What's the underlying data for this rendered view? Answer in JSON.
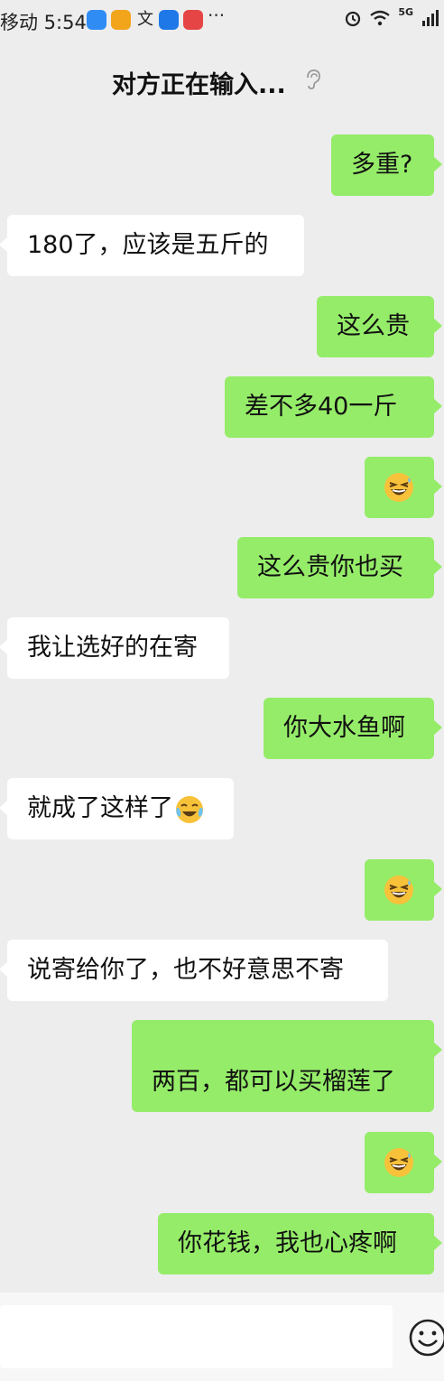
{
  "status_bar": {
    "carrier_time": "移动 5:54",
    "more": "···",
    "network": "5G"
  },
  "header": {
    "title": "对方正在输入..."
  },
  "messages": [
    {
      "side": "me",
      "text": "多重?"
    },
    {
      "side": "them",
      "text": "180了，应该是五斤的"
    },
    {
      "side": "me",
      "text": "这么贵"
    },
    {
      "side": "me",
      "text": "差不多40一斤"
    },
    {
      "side": "me",
      "emoji": "grinning-squint-sweat-emoji"
    },
    {
      "side": "me",
      "text": "这么贵你也买"
    },
    {
      "side": "them",
      "text": "我让选好的在寄"
    },
    {
      "side": "me",
      "text": "你大水鱼啊"
    },
    {
      "side": "them",
      "text": "就成了这样了",
      "trailing_emoji": "crying-laughing-emoji"
    },
    {
      "side": "me",
      "emoji": "grinning-squint-sweat-emoji"
    },
    {
      "side": "them",
      "text": "说寄给你了，也不好意思不寄"
    },
    {
      "side": "me",
      "text": "两百，都可以买榴莲了"
    },
    {
      "side": "me",
      "emoji": "grinning-squint-sweat-emoji"
    },
    {
      "side": "me",
      "text": "你花钱，我也心疼啊"
    }
  ],
  "input": {
    "value": "",
    "placeholder": ""
  },
  "colors": {
    "background": "#ededed",
    "my_bubble": "#95ec69",
    "their_bubble": "#ffffff"
  }
}
